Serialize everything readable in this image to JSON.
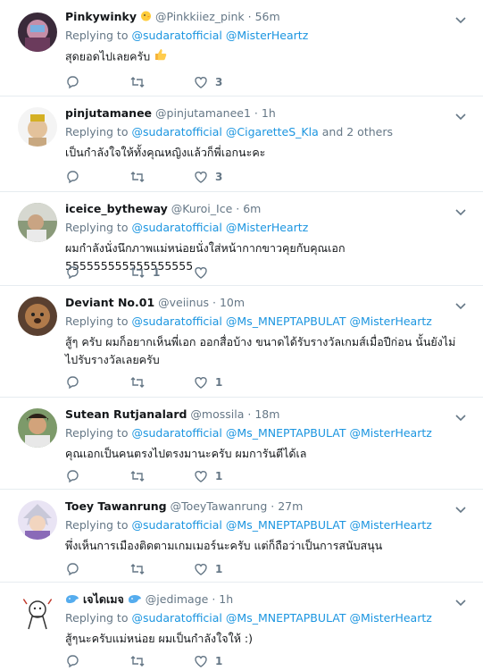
{
  "replying_label": "Replying to",
  "colors": {
    "accent": "#1b95e0",
    "muted": "#657786",
    "divider": "#e6ecf0"
  },
  "tweets": [
    {
      "name": "Pinkywinky",
      "name_emoji": "chick-icon",
      "handle": "@Pinkkiiez_pink",
      "time": "56m",
      "reply_to": [
        "@sudaratofficial",
        "@MisterHeartz"
      ],
      "reply_suffix": "",
      "text": "สุดยอดไปเลยครับ",
      "text_emoji": "thumbs-up-icon",
      "replies": "",
      "retweets": "",
      "likes": "3"
    },
    {
      "name": "pinjutamanee",
      "handle": "@pinjutamanee1",
      "time": "1h",
      "reply_to": [
        "@sudaratofficial",
        "@CigaretteS_Kla"
      ],
      "reply_suffix": "and 2 others",
      "text": "เป็นกำลังใจให้ทั้งคุณหญิงแล้วก็พี่เอกนะคะ",
      "replies": "",
      "retweets": "",
      "likes": "3"
    },
    {
      "name": "iceice_bytheway",
      "handle": "@Kuroi_Ice",
      "time": "6m",
      "reply_to": [
        "@sudaratofficial",
        "@MisterHeartz"
      ],
      "reply_suffix": "",
      "text": "ผมกำลังนั่งนึกภาพแม่หน่อยนั่งใส่หน้ากากขาวคุยกับคุณเอก 555555555555555555",
      "replies": "",
      "retweets": "1",
      "likes": ""
    },
    {
      "name": "Deviant No.01",
      "handle": "@veiinus",
      "time": "10m",
      "reply_to": [
        "@sudaratofficial",
        "@Ms_MNEPTAPBULAT",
        "@MisterHeartz"
      ],
      "reply_suffix": "",
      "text": "สู้ๆ ครับ ผมก็อยากเห็นพี่เอก ออกสื่อบ้าง ขนาดได้รับรางวัลเกมส์เมื่อปีก่อน นั้นยังไม่ไปรับรางวัลเลยครับ",
      "replies": "",
      "retweets": "",
      "likes": "1"
    },
    {
      "name": "Sutean Rutjanalard",
      "handle": "@mossila",
      "time": "18m",
      "reply_to": [
        "@sudaratofficial",
        "@Ms_MNEPTAPBULAT",
        "@MisterHeartz"
      ],
      "reply_suffix": "",
      "text": "คุณเอกเป็นคนตรงไปตรงมานะครับ ผมการันตีได้เล",
      "replies": "",
      "retweets": "",
      "likes": "1"
    },
    {
      "name": "Toey Tawanrung",
      "handle": "@ToeyTawanrung",
      "time": "27m",
      "reply_to": [
        "@sudaratofficial",
        "@Ms_MNEPTAPBULAT",
        "@MisterHeartz"
      ],
      "reply_suffix": "",
      "text": "พึ่งเห็นการเมืองติดตามเกมเมอร์นะครับ แต่ก็ถือว่าเป็นการสนับสนุน",
      "replies": "",
      "retweets": "",
      "likes": "1"
    },
    {
      "name": "เจไดเมจ",
      "name_emoji": "whale-icon",
      "handle": "@jedimage",
      "time": "1h",
      "reply_to": [
        "@sudaratofficial",
        "@Ms_MNEPTAPBULAT",
        "@MisterHeartz"
      ],
      "reply_suffix": "",
      "text": "สู้ๆนะครับแม่หน่อย ผมเป็นกำลังใจให้ :)",
      "replies": "",
      "retweets": "",
      "likes": "1"
    }
  ]
}
